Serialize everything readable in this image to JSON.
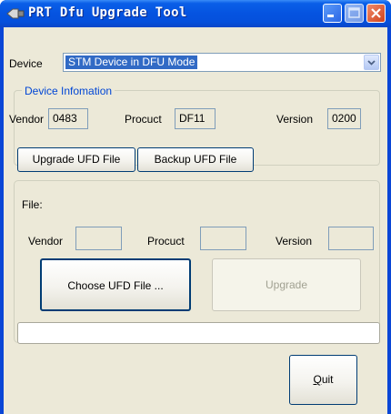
{
  "window": {
    "title": "PRT Dfu Upgrade Tool",
    "title_icon": "usb-plug-icon",
    "controls": [
      "minimize-icon",
      "maximize-icon",
      "close-icon"
    ]
  },
  "device": {
    "label": "Device",
    "selected": "STM Device in DFU Mode",
    "dropdown_icon": "chevron-down-icon"
  },
  "device_info": {
    "group_title": "Device Infomation",
    "vendor_label": "Vendor",
    "vendor_value": "0483",
    "product_label": "Procuct",
    "product_value": "DF11",
    "version_label": "Version",
    "version_value": "0200"
  },
  "tabs": {
    "upgrade": "Upgrade UFD File",
    "backup": "Backup UFD File"
  },
  "file_panel": {
    "file_label": "File:",
    "file_value": "",
    "vendor_label": "Vendor",
    "vendor_value": "",
    "product_label": "Procuct",
    "product_value": "",
    "version_label": "Version",
    "version_value": "",
    "choose_button": "Choose UFD File ...",
    "upgrade_button": "Upgrade"
  },
  "progress": {
    "fraction": 0
  },
  "quit": {
    "label_accel": "Q",
    "label_rest": "uit"
  },
  "colors": {
    "titlebar": "#0553e0",
    "client_background": "#ece9d8",
    "selection": "#316ac5",
    "group_title": "#0046d5"
  }
}
